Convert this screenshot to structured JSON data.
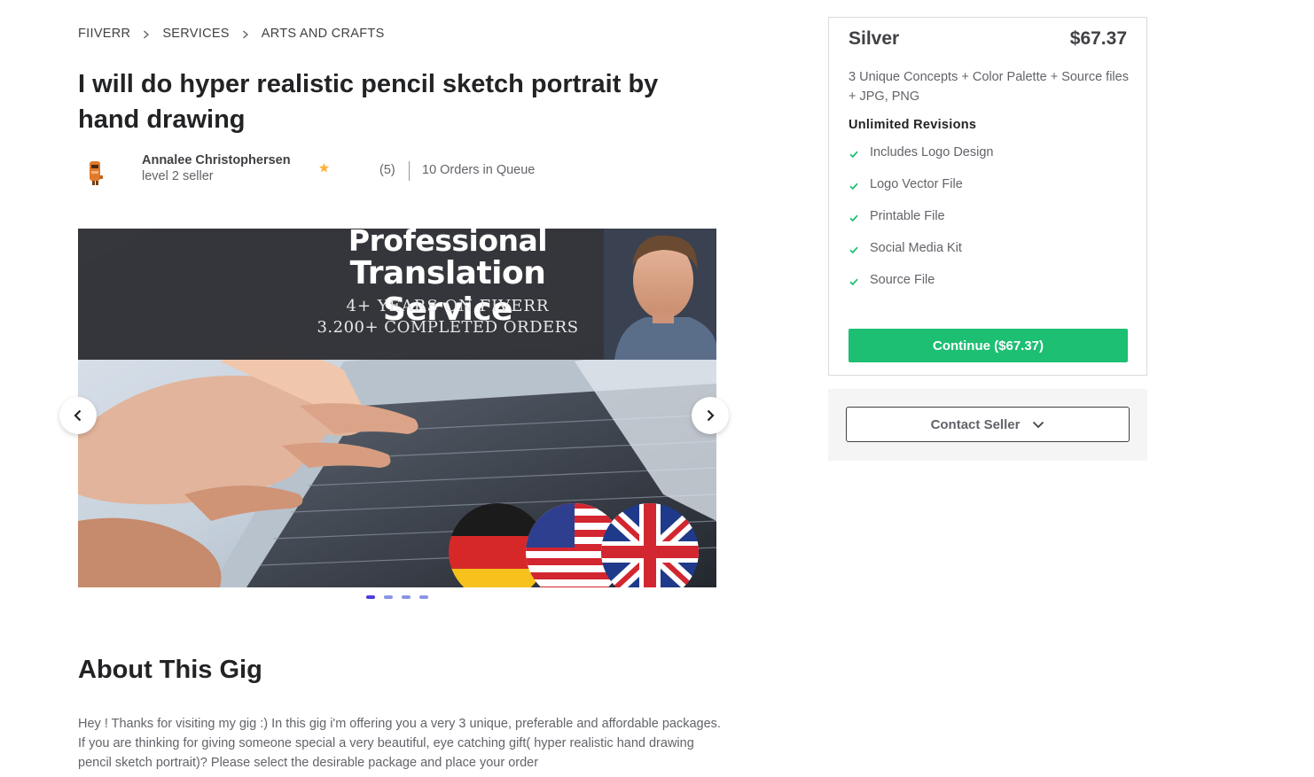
{
  "breadcrumb": [
    "FIIVERR",
    "SERVICES",
    "ARTS AND CRAFTS"
  ],
  "gig": {
    "title": "I will do hyper realistic pencil sketch portrait by hand drawing"
  },
  "seller": {
    "name": "Annalee Christophersen",
    "level": "level 2 seller",
    "rating_count": "(5)",
    "orders_queue": "10 Orders in Queue"
  },
  "gallery": {
    "line1": "Professional",
    "line2": "Translation Service",
    "line3": "4+ YEARS ON FIVERR",
    "line4": "3.200+ COMPLETED ORDERS",
    "slide_count": 4,
    "active_slide": 1
  },
  "about": {
    "heading": "About This Gig",
    "text": "Hey ! Thanks for visiting my gig :) In this gig i'm offering you a very 3 unique, preferable and affordable packages. If you are thinking for giving someone special a very beautiful, eye catching gift( hyper realistic hand drawing pencil sketch portrait)? Please select the desirable package and place your order"
  },
  "package": {
    "name": "Silver",
    "price": "$67.37",
    "description": "3 Unique Concepts + Color Palette + Source files + JPG, PNG",
    "revisions": "Unlimited Revisions",
    "features": [
      "Includes Logo Design",
      "Logo Vector File",
      "Printable File",
      "Social Media Kit",
      "Source File"
    ],
    "continue_label": "Continue ($67.37)"
  },
  "contact": {
    "label": "Contact Seller"
  },
  "colors": {
    "accent_green": "#1dbf73",
    "star": "#ffb33e",
    "dot_active": "#4a3cdd",
    "dot_inactive": "#8a95e6"
  }
}
